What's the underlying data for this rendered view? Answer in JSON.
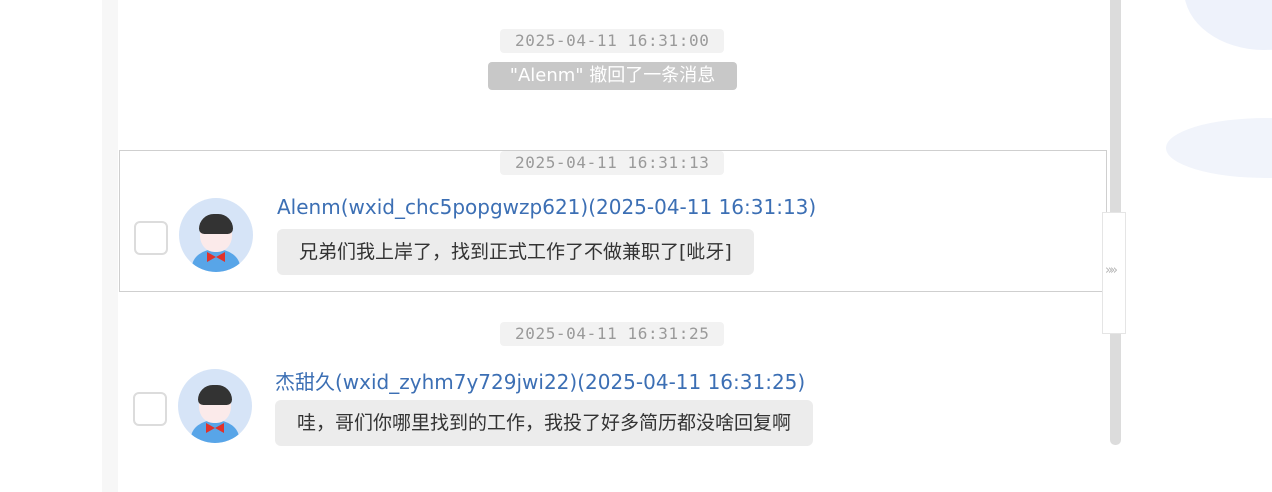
{
  "chat": {
    "recall_timestamp": "2025-04-11 16:31:00",
    "recall_notice": "\"Alenm\" 撤回了一条消息",
    "messages": [
      {
        "timestamp": "2025-04-11 16:31:13",
        "sender": "Alenm(wxid_chc5popgwzp621)(2025-04-11 16:31:13)",
        "text": "兄弟们我上岸了，找到正式工作了不做兼职了[呲牙]",
        "selected": true
      },
      {
        "timestamp": "2025-04-11 16:31:25",
        "sender": "杰甜久(wxid_zyhm7y729jwi22)(2025-04-11 16:31:25)",
        "text": "哇，哥们你哪里找到的工作，我投了好多简历都没啥回复啊",
        "selected": false
      }
    ]
  },
  "side_handle": {
    "icon": "double-chevron-right-icon",
    "glyph": "»»"
  },
  "colors": {
    "sender": "#3c6fb4",
    "bubble": "#ececec",
    "timestamp_bg": "#f2f2f2",
    "recall_bg": "#c8c8c8"
  }
}
